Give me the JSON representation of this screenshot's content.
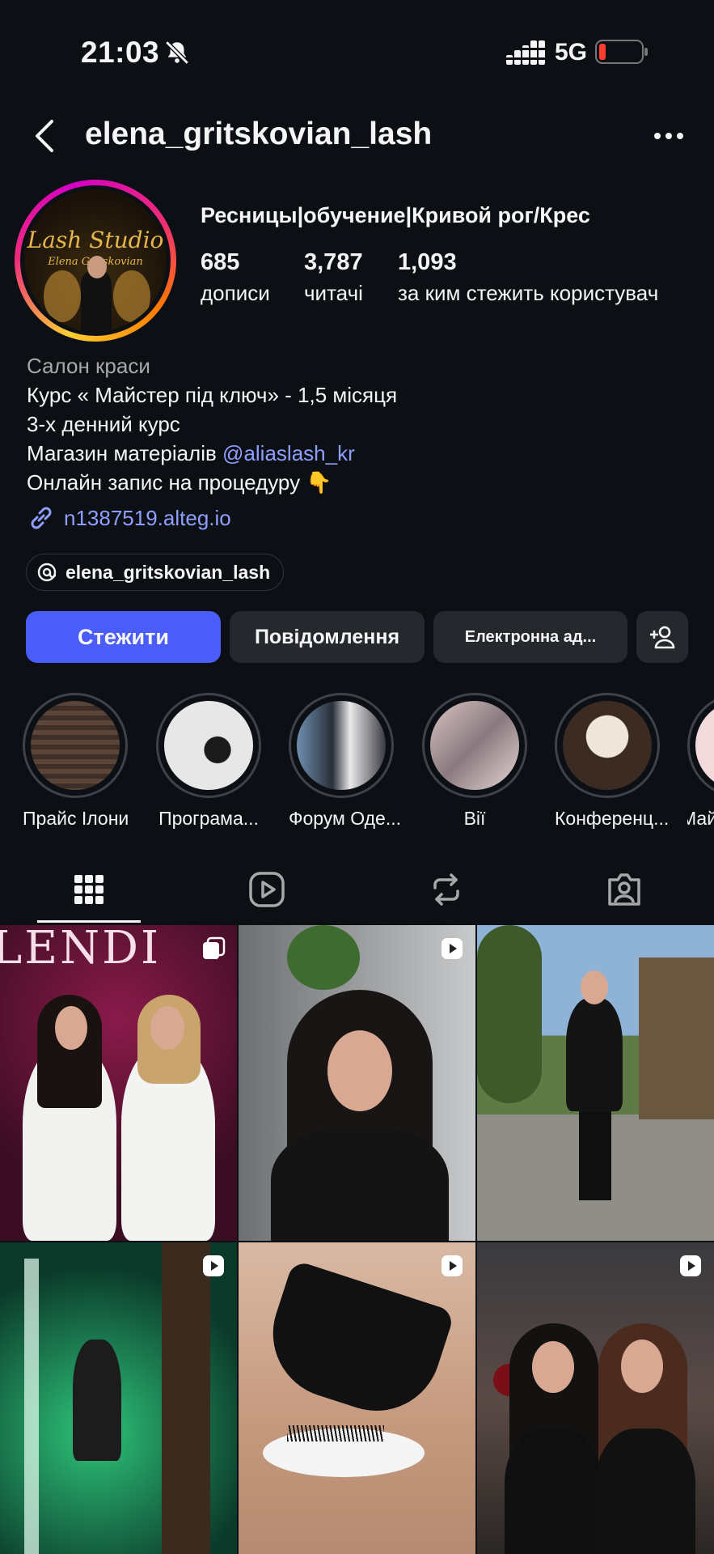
{
  "status": {
    "time": "21:03",
    "network": "5G",
    "colors": {
      "battery_low": "#ff3b30"
    }
  },
  "header": {
    "username": "elena_gritskovian_lash",
    "icons": {
      "back": "chevron-left-icon",
      "more": "more-horizontal-icon"
    }
  },
  "profile": {
    "avatar_text": "Lash Studio",
    "avatar_subtext": "Elena Gritskovian",
    "display_name": "Ресницы|обучение|Кривой рог/Крес",
    "stats": [
      {
        "value": "685",
        "label": "дописи"
      },
      {
        "value": "3,787",
        "label": "читачі"
      },
      {
        "value": "1,093",
        "label": "за ким стежить користувач"
      }
    ]
  },
  "bio": {
    "category": "Салон краси",
    "line1": "Курс « Майстер під ключ» - 1,5 місяця",
    "line2": "3-х денний курс",
    "line3_prefix": "Магазин матеріалів ",
    "mention": "@aliaslash_kr",
    "line4": "Онлайн запис на процедуру 👇",
    "link": "n1387519.alteg.io",
    "threads_handle": "elena_gritskovian_lash"
  },
  "actions": {
    "follow": "Стежити",
    "message": "Повідомлення",
    "email": "Електронна ад...",
    "colors": {
      "follow_bg": "#4a5df9",
      "secondary_bg": "#25292e"
    }
  },
  "highlights": [
    {
      "label": "Прайс Ілони"
    },
    {
      "label": "Програма..."
    },
    {
      "label": "Форум Оде..."
    },
    {
      "label": "Вії"
    },
    {
      "label": "Конференц..."
    },
    {
      "label": "Май"
    }
  ],
  "tabs": {
    "items": [
      "grid-icon",
      "reels-icon",
      "reposts-icon",
      "tagged-icon"
    ],
    "active": "grid-icon"
  },
  "posts": [
    {
      "type": "carousel",
      "caption_text": "LENDI"
    },
    {
      "type": "reel"
    },
    {
      "type": "photo"
    },
    {
      "type": "reel"
    },
    {
      "type": "reel"
    },
    {
      "type": "reel"
    }
  ]
}
